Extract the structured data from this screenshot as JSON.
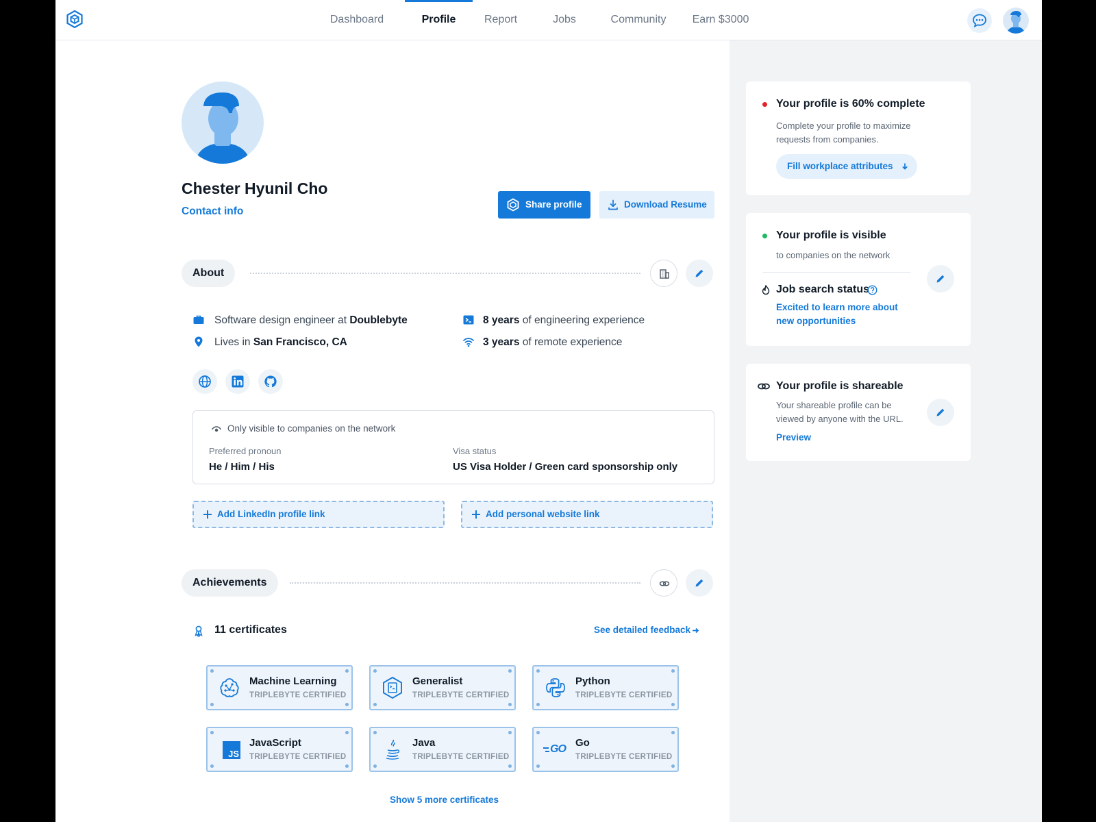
{
  "nav": {
    "items": [
      {
        "label": "Dashboard",
        "active": false
      },
      {
        "label": "Profile",
        "active": true
      },
      {
        "label": "Report",
        "active": false
      },
      {
        "label": "Jobs",
        "active": false
      },
      {
        "label": "Community",
        "active": false
      },
      {
        "label": "Earn $3000",
        "active": false
      }
    ]
  },
  "profile": {
    "name": "Chester Hyunil Cho",
    "contact_label": "Contact info",
    "share_label": "Share profile",
    "download_label": "Download Resume"
  },
  "about": {
    "title": "About",
    "role_prefix": "Software design engineer at ",
    "company": "Doublebyte",
    "location_prefix": "Lives in ",
    "location": "San Francisco, CA",
    "eng_years": "8 years",
    "eng_suffix": " of engineering experience",
    "remote_years": "3 years",
    "remote_suffix": " of remote experience",
    "private_note": "Only visible to companies on the network",
    "pronoun_label": "Preferred pronoun",
    "pronoun_value": "He / Him / His",
    "visa_label": "Visa status",
    "visa_value": "US Visa Holder / Green card sponsorship only",
    "add_linkedin": "Add LinkedIn profile link",
    "add_website": "Add personal website link"
  },
  "achievements": {
    "title": "Achievements",
    "count_label": "11 certificates",
    "feedback_link": "See detailed feedback",
    "certificates": [
      {
        "name": "Machine Learning",
        "sub": "TRIPLEBYTE CERTIFIED",
        "icon": "brain-icon"
      },
      {
        "name": "Generalist",
        "sub": "TRIPLEBYTE CERTIFIED",
        "icon": "hexagon-doc-icon"
      },
      {
        "name": "Python",
        "sub": "TRIPLEBYTE CERTIFIED",
        "icon": "python-icon"
      },
      {
        "name": "JavaScript",
        "sub": "TRIPLEBYTE CERTIFIED",
        "icon": "js-icon"
      },
      {
        "name": "Java",
        "sub": "TRIPLEBYTE CERTIFIED",
        "icon": "java-icon"
      },
      {
        "name": "Go",
        "sub": "TRIPLEBYTE CERTIFIED",
        "icon": "go-icon"
      }
    ],
    "more_label": "Show 5 more certificates",
    "js_badge": "JS",
    "go_badge": "GO"
  },
  "sidebar": {
    "complete": {
      "title": "Your profile is 60% complete",
      "text1": "Complete your profile to maximize",
      "text2": "requests from companies.",
      "button": "Fill workplace attributes",
      "dot_color": "#e0262b"
    },
    "visible": {
      "title": "Your profile is visible",
      "text": "to companies on the network",
      "job_title": "Job search status",
      "job_line1": "Excited to learn more about",
      "job_line2": "new opportunities",
      "dot_color": "#1fb863"
    },
    "shareable": {
      "title": "Your profile is shareable",
      "text1": "Your shareable profile can be",
      "text2": "viewed by anyone with the URL.",
      "link": "Preview"
    }
  },
  "colors": {
    "accent": "#1479d8",
    "sidebar_bg": "#f1f3f5"
  }
}
